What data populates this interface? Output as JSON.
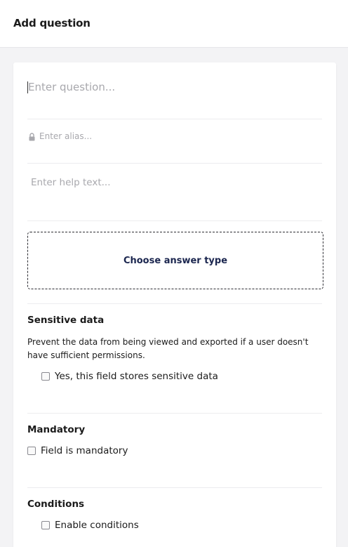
{
  "header": {
    "title": "Add question"
  },
  "form": {
    "question_placeholder": "Enter question...",
    "alias_placeholder": "Enter alias...",
    "help_placeholder": "Enter help text...",
    "answer_type_label": "Choose answer type"
  },
  "sensitive": {
    "title": "Sensitive data",
    "description": "Prevent the data from being viewed and exported if a user doesn't have sufficient permissions.",
    "checkbox_label": "Yes, this field stores sensitive data",
    "checked": false
  },
  "mandatory": {
    "title": "Mandatory",
    "checkbox_label": "Field is mandatory",
    "checked": false
  },
  "conditions": {
    "title": "Conditions",
    "checkbox_label": "Enable conditions",
    "checked": false
  },
  "icons": {
    "alias": "lock-icon"
  }
}
